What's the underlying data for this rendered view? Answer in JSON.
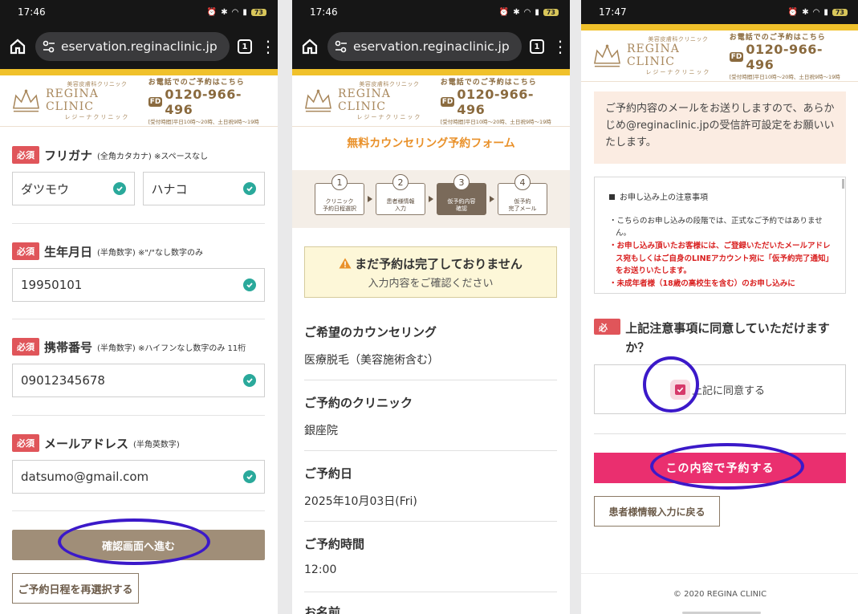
{
  "colors": {
    "accent": "#f0c12b",
    "brand": "#a9885d",
    "required": "#e0555a",
    "primary_button": "#ea2f6f",
    "confirm_button": "#a08e78",
    "check": "#2aa99b",
    "annotation": "#3b19c9"
  },
  "panels": [
    {
      "status": {
        "time": "17:46",
        "battery": "73"
      },
      "url": "eservation.reginaclinic.jp",
      "tab_count": "1",
      "header": {
        "logo_small": "美容皮膚科クリニック",
        "logo_main": "REGINA CLINIC",
        "logo_kana": "レジーナクリニック",
        "phone_caption": "お電話でのご予約はこちら",
        "free_badge": "FD",
        "phone_number": "0120-966-496",
        "phone_hours": "[受付時間]平日10時～20時、土日祝9時～19時"
      },
      "form": {
        "required_label": "必須",
        "furigana": {
          "label": "フリガナ",
          "note": "(全角カタカナ) ※スペースなし",
          "last": "ダツモウ",
          "first": "ハナコ"
        },
        "birthday": {
          "label": "生年月日",
          "note": "(半角数字) ※\"/\"なし数字のみ",
          "value": "19950101"
        },
        "mobile": {
          "label": "携帯番号",
          "note": "(半角数字) ※ハイフンなし数字のみ 11桁",
          "value": "09012345678"
        },
        "email": {
          "label": "メールアドレス",
          "note": "(半角英数字)",
          "value": "datsumo@gmail.com"
        },
        "confirm_button": "確認画面へ進む",
        "reselect_button": "ご予約日程を再選択する"
      }
    },
    {
      "status": {
        "time": "17:46",
        "battery": "73"
      },
      "url": "eservation.reginaclinic.jp",
      "tab_count": "1",
      "header": {
        "logo_small": "美容皮膚科クリニック",
        "logo_main": "REGINA CLINIC",
        "logo_kana": "レジーナクリニック",
        "phone_caption": "お電話でのご予約はこちら",
        "free_badge": "FD",
        "phone_number": "0120-966-496",
        "phone_hours": "[受付時間]平日10時～20時、土日祝9時～19時"
      },
      "form_title": "無料カウンセリング予約フォーム",
      "steps": [
        {
          "num": "1",
          "label": "クリニック\n予約日程選択"
        },
        {
          "num": "2",
          "label": "患者様情報\n入力"
        },
        {
          "num": "3",
          "label": "仮予約内容\n確認"
        },
        {
          "num": "4",
          "label": "仮予約\n完了メール"
        }
      ],
      "warning": {
        "title": "まだ予約は完了しておりません",
        "sub": "入力内容をご確認ください"
      },
      "confirm": [
        {
          "label": "ご希望のカウンセリング",
          "value": "医療脱毛（美容施術含む）"
        },
        {
          "label": "ご予約のクリニック",
          "value": "銀座院"
        },
        {
          "label": "ご予約日",
          "value": "2025年10月03日(Fri)"
        },
        {
          "label": "ご予約時間",
          "value": "12:00"
        },
        {
          "label": "お名前",
          "value": ""
        }
      ]
    },
    {
      "status": {
        "time": "17:47",
        "battery": "73"
      },
      "header": {
        "logo_small": "美容皮膚科クリニック",
        "logo_main": "REGINA CLINIC",
        "logo_kana": "レジーナクリニック",
        "phone_caption": "お電話でのご予約はこちら",
        "free_badge": "FD",
        "phone_number": "0120-966-496",
        "phone_hours": "[受付時間]平日10時～20時、土日祝9時～19時"
      },
      "notice": "ご予約内容のメールをお送りしますので、あらかじめ@reginaclinic.jpの受信許可設定をお願いいたします。",
      "terms": {
        "heading": "お申し込み上の注意事項",
        "items": [
          {
            "text": "こちらのお申し込みの段階では、正式なご予約ではありません。",
            "red": false
          },
          {
            "text": "お申し込み頂いたお客様には、ご登録いただいたメールアドレス宛もしくはご自身のLINEアカウント宛に「仮予約完了通知」をお送りいたします。",
            "red": true
          },
          {
            "text": "未成年者様（18歳の高校生を含む）のお申し込みに",
            "red": true
          }
        ]
      },
      "agree_question": "上記注意事項に同意していただけますか？",
      "agree_label": "上記に同意する",
      "reserve_button": "この内容で予約する",
      "back_button": "患者様情報入力に戻る",
      "footer": "© 2020 REGINA CLINIC"
    }
  ]
}
